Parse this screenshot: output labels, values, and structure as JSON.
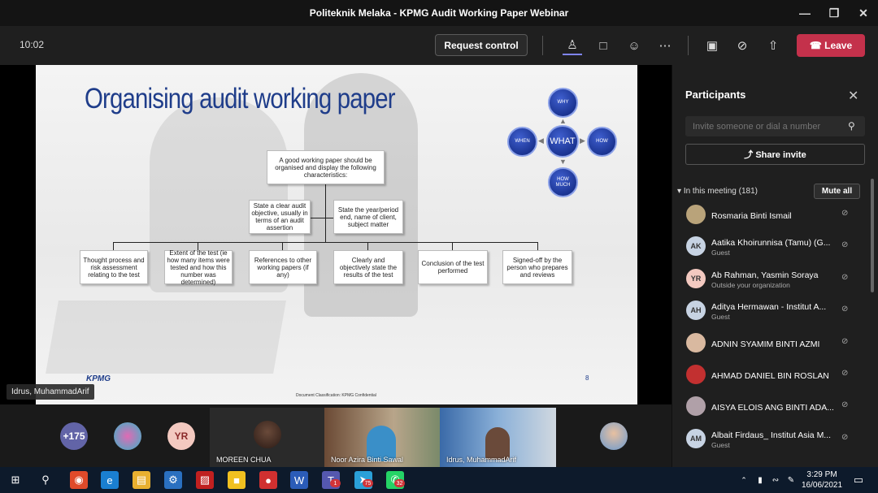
{
  "window": {
    "title": "Politeknik Melaka - KPMG Audit Working Paper Webinar"
  },
  "toolbar": {
    "time": "10:02",
    "request_control": "Request control",
    "leave": "Leave"
  },
  "slide": {
    "title": "Organising audit working paper",
    "root_box": "A good working paper should be organised and display the following characteristics:",
    "mid_boxes": [
      "State a clear audit objective, usually in terms of an audit assertion",
      "State the year/period end, name of client, subject matter"
    ],
    "bottom_boxes": [
      "Thought process and risk assessment relating to the test",
      "Extent of the test (ie how many items were tested and how this number was determined)",
      "References to other working papers (if any)",
      "Clearly and objectively state the results of the test",
      "Conclusion of the test performed",
      "Signed-off by the person who prepares and reviews"
    ],
    "wheel": {
      "center": "WHAT",
      "top": "WHY",
      "left": "WHEN",
      "right": "HOW",
      "bottom": "HOW MUCH"
    },
    "logo": "KPMG",
    "page_number": "8",
    "classification": "Document Classification: KPMG Confidential",
    "presenter": "Idrus, MuhammadArif"
  },
  "gallery": {
    "overflow_count": "+175",
    "yr_initials": "YR",
    "tiles": [
      "MOREEN CHUA",
      "Noor Azira Binti Sawal",
      "Idrus, MuhammadArif"
    ]
  },
  "panel": {
    "title": "Participants",
    "invite_placeholder": "Invite someone or dial a number",
    "share_invite": "Share invite",
    "in_meeting": "In this meeting (181)",
    "mute_all": "Mute all",
    "participants": [
      {
        "name": "Rosmaria Binti Ismail",
        "sub": "",
        "initials": "",
        "color": "#b9a37a"
      },
      {
        "name": "Aatika Khoirunnisa (Tamu) (G...",
        "sub": "Guest",
        "initials": "AK",
        "color": "#c7d3e3"
      },
      {
        "name": "Ab Rahman, Yasmin Soraya",
        "sub": "Outside your organization",
        "initials": "YR",
        "color": "#f3c9c0"
      },
      {
        "name": "Aditya Hermawan - Institut A...",
        "sub": "Guest",
        "initials": "AH",
        "color": "#c7d3e3"
      },
      {
        "name": "ADNIN SYAMIM BINTI AZMI",
        "sub": "",
        "initials": "",
        "color": "#d9b9a0"
      },
      {
        "name": "AHMAD DANIEL BIN ROSLAN",
        "sub": "",
        "initials": "",
        "color": "#c23030"
      },
      {
        "name": "AISYA ELOIS ANG BINTI ADA...",
        "sub": "",
        "initials": "",
        "color": "#b0a0a8"
      },
      {
        "name": "Albait Firdaus_ Institut Asia M...",
        "sub": "Guest",
        "initials": "AM",
        "color": "#c7d3e3"
      }
    ]
  },
  "taskbar": {
    "time": "3:29 PM",
    "date": "16/06/2021",
    "badges": [
      "1",
      "75",
      "32"
    ]
  }
}
